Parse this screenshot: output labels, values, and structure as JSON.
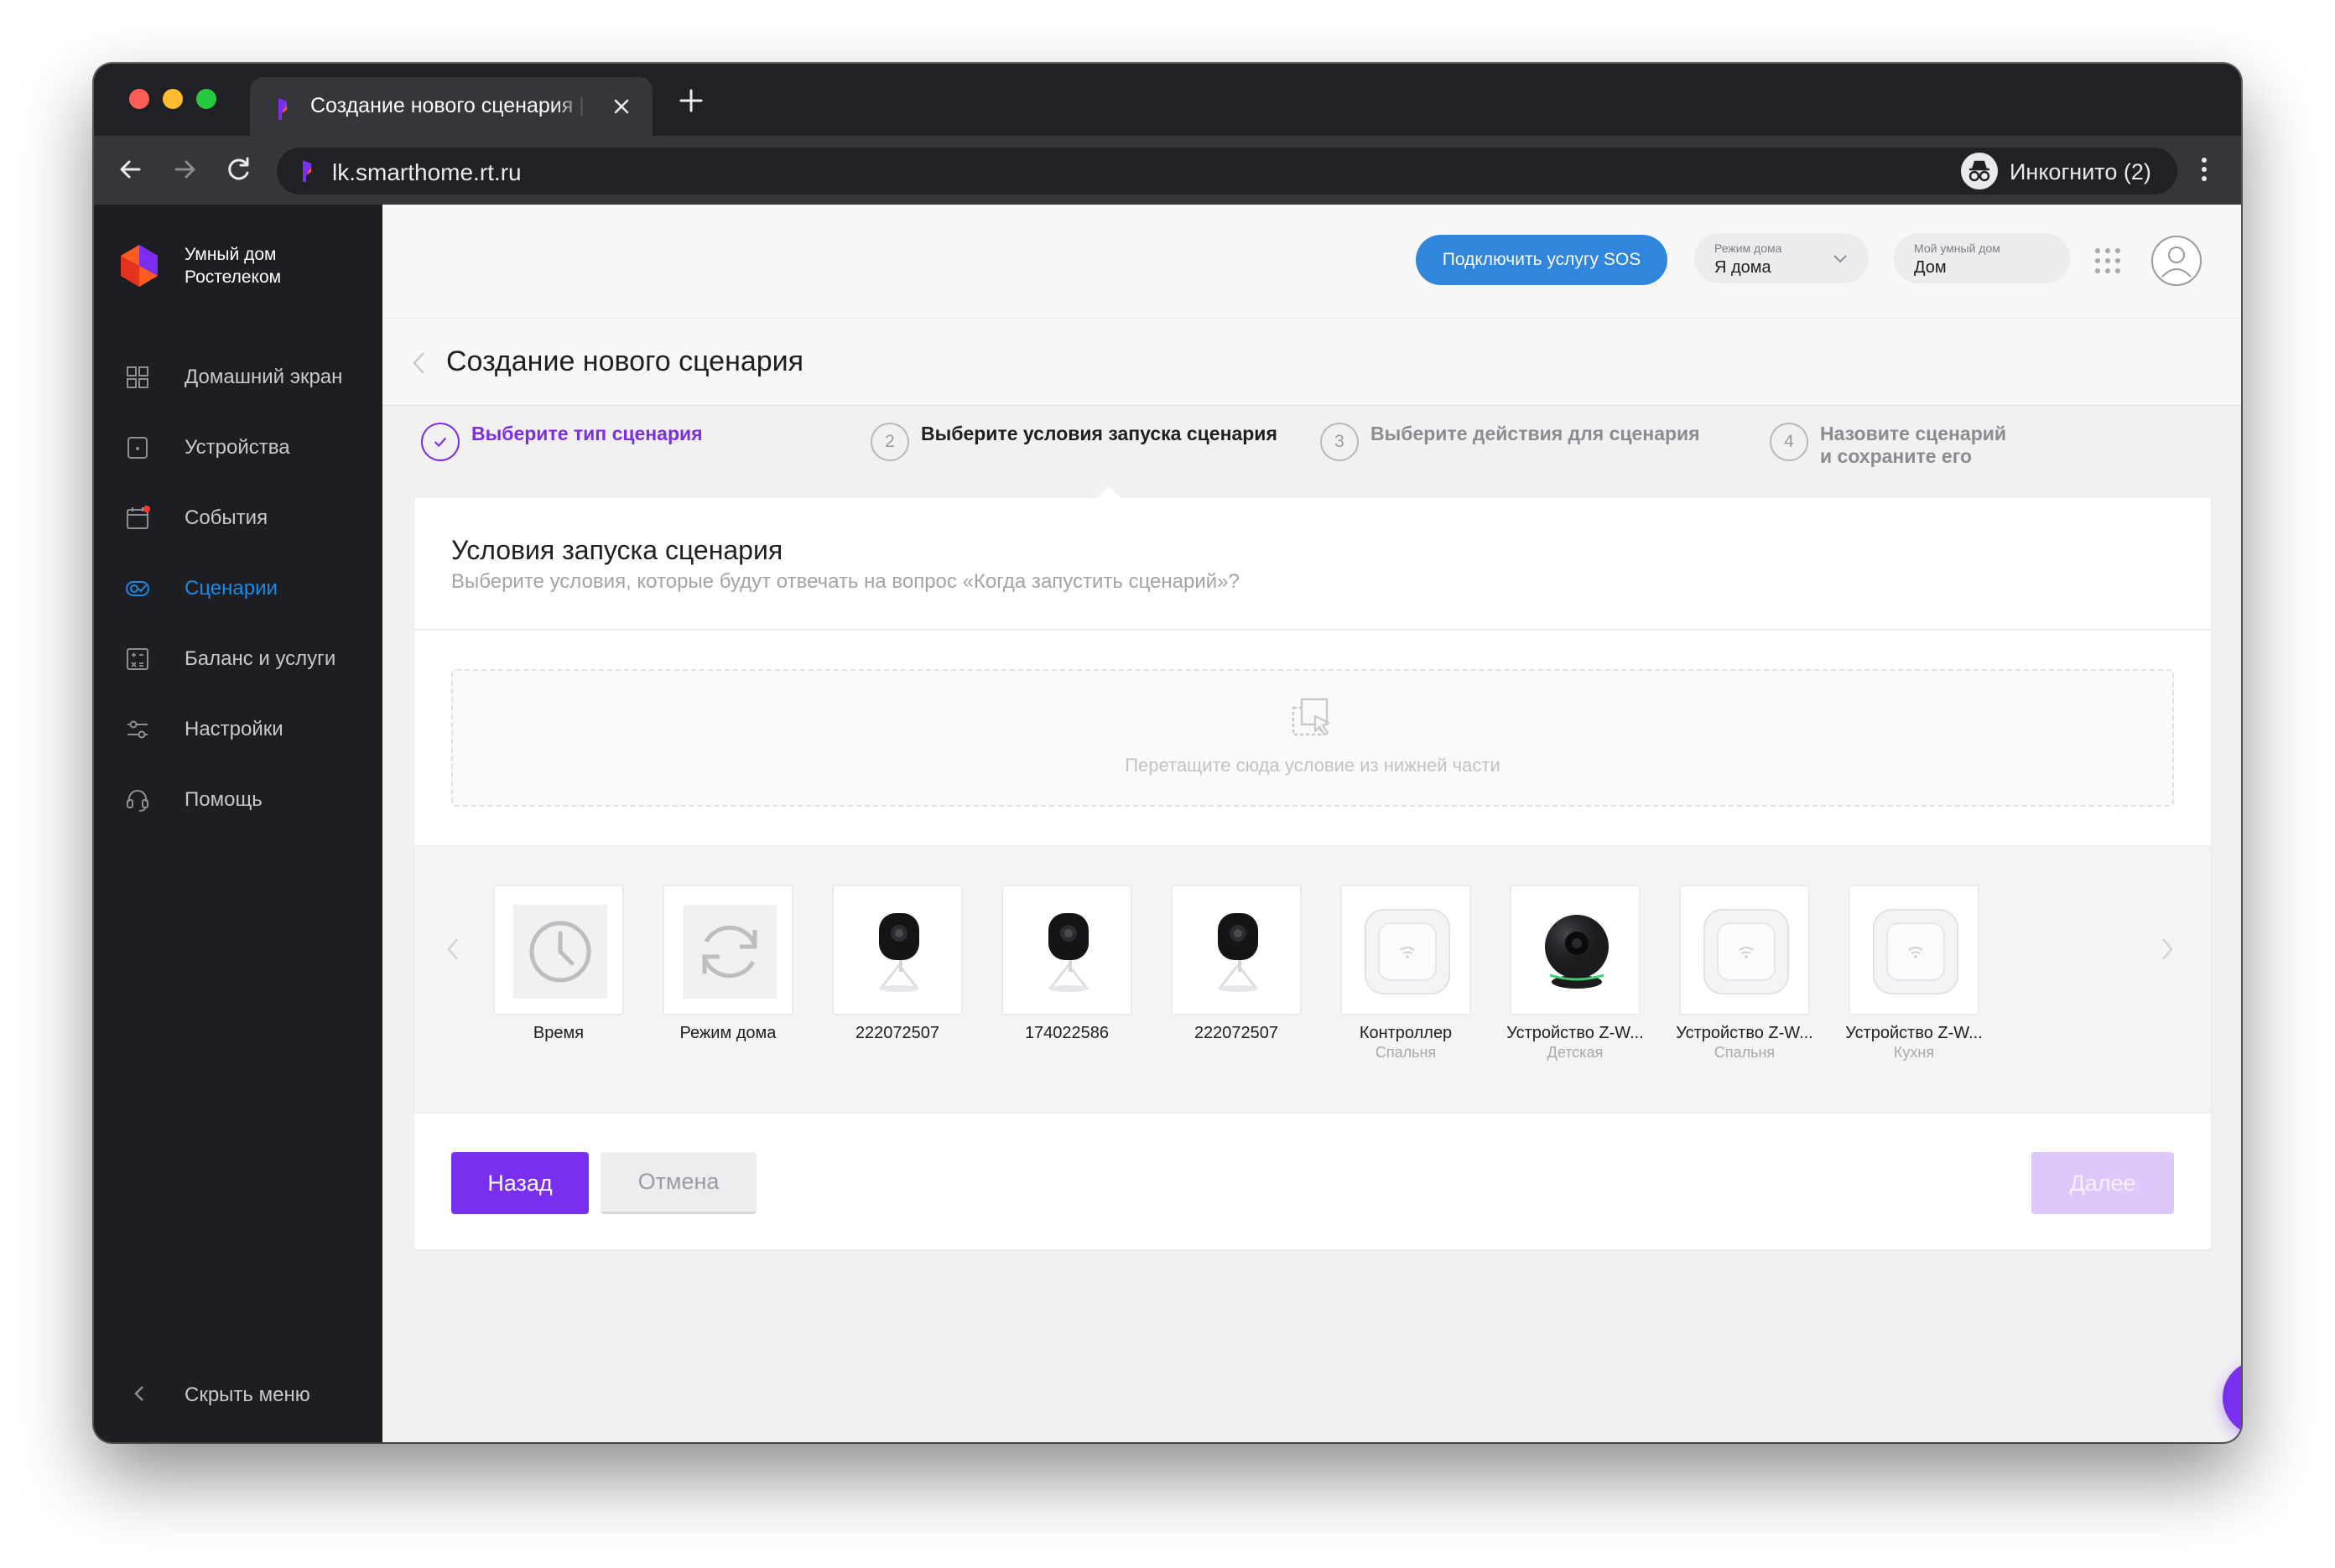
{
  "browser": {
    "tab_title": "Создание нового сценария | У",
    "url": "lk.smarthome.rt.ru",
    "incognito_label": "Инкогнито (2)"
  },
  "sidebar": {
    "brand": [
      "Умный дом",
      "Ростелеком"
    ],
    "items": [
      {
        "label": "Домашний экран",
        "icon": "grid-icon",
        "active": false
      },
      {
        "label": "Устройства",
        "icon": "device-icon",
        "active": false
      },
      {
        "label": "События",
        "icon": "calendar-icon",
        "active": false
      },
      {
        "label": "Сценарии",
        "icon": "scenario-icon",
        "active": true
      },
      {
        "label": "Баланс и услуги",
        "icon": "calculator-icon",
        "active": false
      },
      {
        "label": "Настройки",
        "icon": "sliders-icon",
        "active": false
      },
      {
        "label": "Помощь",
        "icon": "headset-icon",
        "active": false
      }
    ],
    "collapse_label": "Скрыть меню"
  },
  "topbar": {
    "sos_button": "Подключить услугу SOS",
    "mode_caption": "Режим дома",
    "mode_value": "Я дома",
    "home_caption": "Мой умный дом",
    "home_value": "Дом"
  },
  "page": {
    "title": "Создание нового сценария"
  },
  "steps": [
    {
      "number": "1",
      "label": "Выберите тип сценария",
      "state": "done"
    },
    {
      "number": "2",
      "label": "Выберите условия запуска сценария",
      "state": "current"
    },
    {
      "number": "3",
      "label": "Выберите действия для сценария",
      "state": "todo"
    },
    {
      "number": "4",
      "label": "Назовите сценарий\nи сохраните его",
      "state": "todo"
    }
  ],
  "card": {
    "title": "Условия запуска сценария",
    "subtitle": "Выберите условия, которые будут отвечать на вопрос «Когда запустить сценарий»?",
    "dropzone_text": "Перетащите сюда условие из нижней части"
  },
  "tiles": [
    {
      "name": "Время",
      "room": "",
      "icon": "clock-icon"
    },
    {
      "name": "Режим дома",
      "room": "",
      "icon": "refresh-icon"
    },
    {
      "name": "222072507",
      "room": "",
      "icon": "camera-icon"
    },
    {
      "name": "174022586",
      "room": "",
      "icon": "camera-icon"
    },
    {
      "name": "222072507",
      "room": "",
      "icon": "camera-icon"
    },
    {
      "name": "Контроллер",
      "room": "Спальня",
      "icon": "controller-icon"
    },
    {
      "name": "Устройство Z-W...",
      "room": "Детская",
      "icon": "dome-camera-icon"
    },
    {
      "name": "Устройство Z-W...",
      "room": "Спальня",
      "icon": "controller-icon"
    },
    {
      "name": "Устройство Z-W...",
      "room": "Кухня",
      "icon": "controller-icon"
    }
  ],
  "buttons": {
    "back": "Назад",
    "cancel": "Отмена",
    "next": "Далее"
  },
  "colors": {
    "accent": "#7a2ef0",
    "sos": "#2f86dc",
    "active_nav": "#1e88e5"
  }
}
